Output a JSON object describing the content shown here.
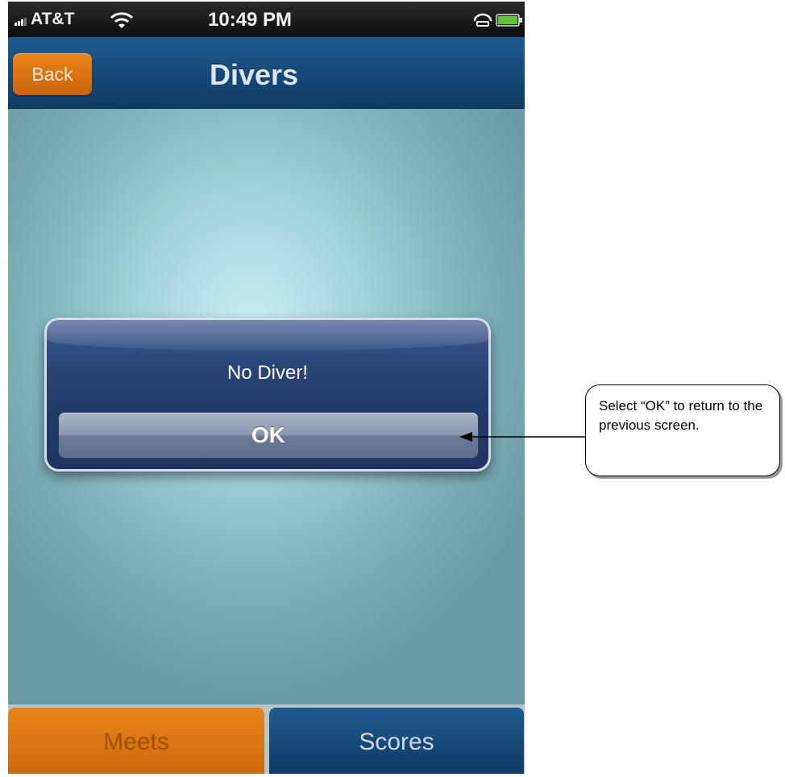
{
  "status_bar": {
    "carrier": "AT&T",
    "time": "10:49 PM"
  },
  "nav_bar": {
    "back_label": "Back",
    "title": "Divers"
  },
  "alert": {
    "message": "No Diver!",
    "ok_label": "OK"
  },
  "tab_bar": {
    "tabs": [
      {
        "label": "Meets",
        "active": true
      },
      {
        "label": "Scores",
        "active": false
      }
    ]
  },
  "callout": {
    "text": "Select “OK” to return to the previous screen."
  },
  "colors": {
    "nav_blue": "#174c7c",
    "accent_orange": "#e07a16",
    "alert_blue": "#2b4678"
  }
}
